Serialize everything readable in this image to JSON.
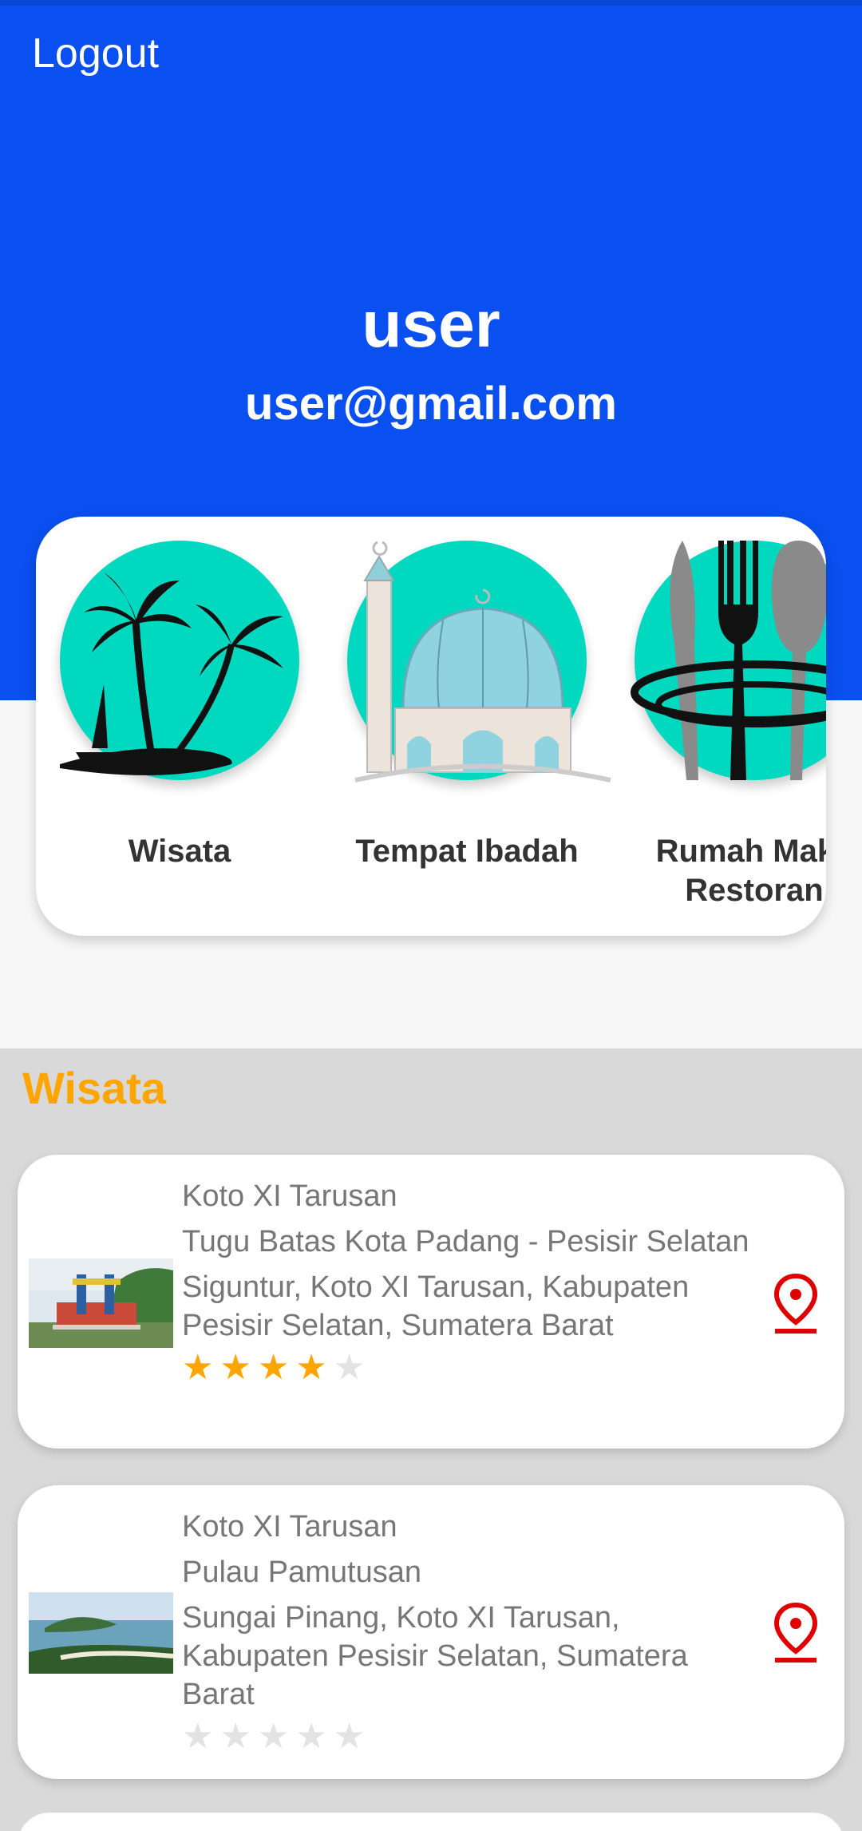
{
  "header": {
    "logout_label": "Logout",
    "user_name": "user",
    "user_email": "user@gmail.com"
  },
  "categories": [
    {
      "label": "Wisata",
      "icon": "palm-island-icon"
    },
    {
      "label": "Tempat Ibadah",
      "icon": "mosque-icon"
    },
    {
      "label": "Rumah Maka\nRestoran",
      "icon": "cutlery-icon"
    }
  ],
  "section_title": "Wisata",
  "items": [
    {
      "district": "Koto XI Tarusan",
      "name": "Tugu Batas Kota Padang - Pesisir Selatan",
      "address": "Siguntur, Koto XI Tarusan, Kabupaten Pesisir Selatan, Sumatera Barat",
      "rating": 4,
      "max_rating": 5
    },
    {
      "district": "Koto XI Tarusan",
      "name": "Pulau Pamutusan",
      "address": "Sungai Pinang, Koto XI Tarusan, Kabupaten Pesisir Selatan, Sumatera Barat",
      "rating": 0,
      "max_rating": 5
    }
  ],
  "colors": {
    "header_blue": "#0a50f0",
    "accent_orange": "#ffa500",
    "category_teal": "#00d8c0",
    "pin_red": "#e00000",
    "star_filled": "#ffa500",
    "star_empty": "#e3e3e3"
  }
}
